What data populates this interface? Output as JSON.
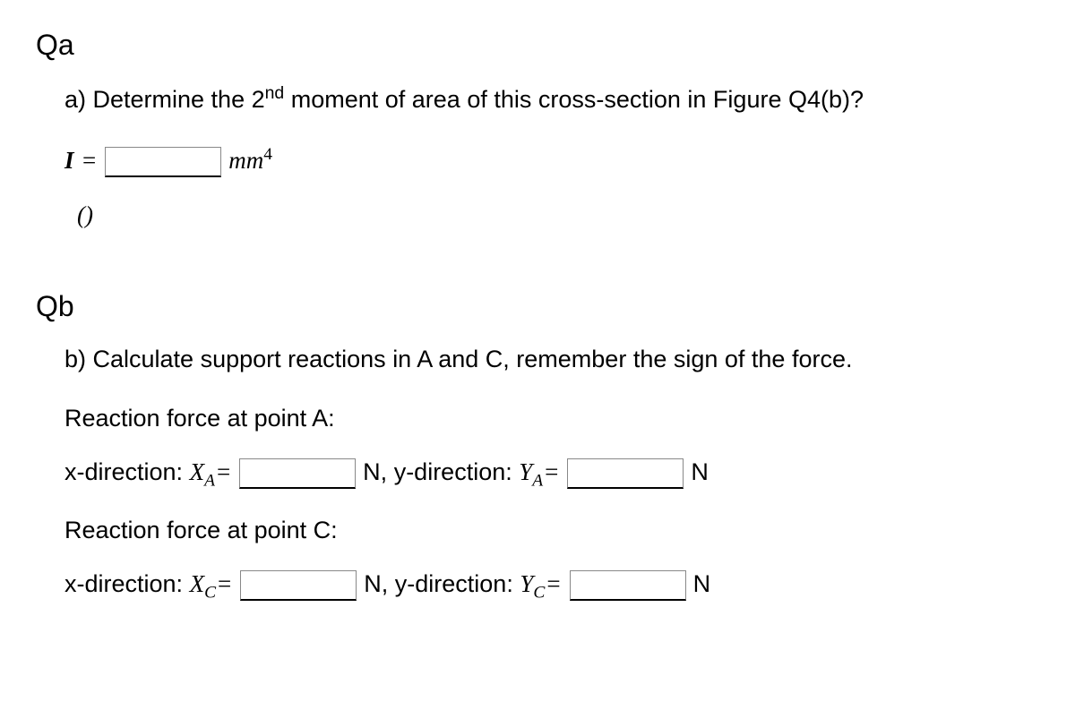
{
  "qa": {
    "heading": "Qa",
    "question": "a) Determine the 2",
    "question_sup": "nd",
    "question_cont": " moment of area of this cross-section in Figure Q4(b)?",
    "I_label": "I",
    "equals": "=",
    "unit_mm": "mm",
    "unit_exp": "4",
    "parens": "()"
  },
  "qb": {
    "heading": "Qb",
    "question": "b) Calculate support reactions in A and C, remember the sign of the force.",
    "rf_a": "Reaction force at point A:",
    "rf_c": "Reaction force at point C:",
    "xdir": "x-direction: ",
    "ydir": "y-direction: ",
    "X": "X",
    "Y": "Y",
    "subA": "A",
    "subC": "C",
    "eq": "=",
    "N_comma": "N, ",
    "N": "N"
  }
}
